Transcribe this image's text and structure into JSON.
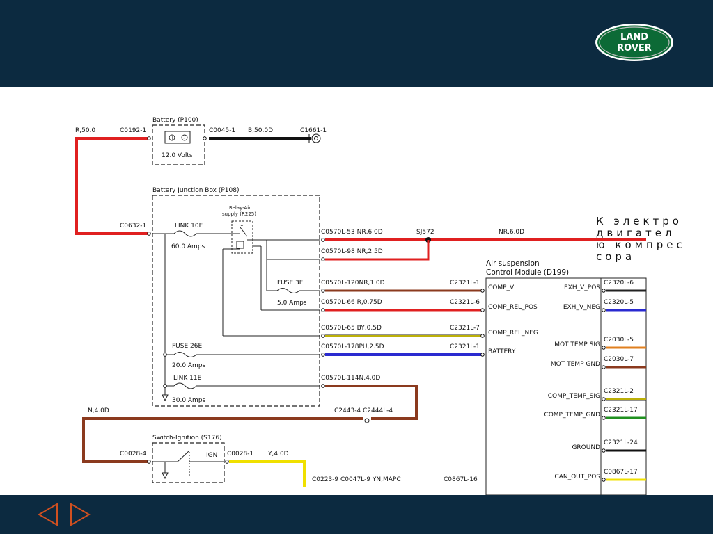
{
  "brand": {
    "logo_line1": "LAND",
    "logo_line2": "ROVER"
  },
  "annotation": "К электродвигателю компрессора",
  "battery": {
    "title": "Battery (P100)",
    "voltage": "12.0 Volts",
    "wire_in": "R,50.0",
    "conn_in": "C0192-1",
    "conn_out": "C0045-1",
    "wire_out": "B,50.0D",
    "ground": "C1661-1"
  },
  "junction_box": {
    "title": "Battery Junction Box (P108)",
    "conn": "C0632-1",
    "link10e": "LINK 10E",
    "link10e_amps": "60.0 Amps",
    "relay_title": "Relay-Air",
    "relay_sub": "supply (R225)",
    "relay_pin": "1",
    "fuse3e": "FUSE 3E",
    "fuse3e_amps": "5.0 Amps",
    "fuse26e": "FUSE 26E",
    "fuse26e_amps": "20.0 Amps",
    "link11e": "LINK 11E",
    "link11e_amps": "30.0 Amps"
  },
  "wires": {
    "w1": "C0570L-53 NR,6.0D",
    "splice": "SJ572",
    "w1b": "NR,6.0D",
    "w2": "C0570L-98 NR,2.5D",
    "w3": "C0570L-120NR,1.0D",
    "w3c": "C2321L-1",
    "w4": "C0570L-66 R,0.75D",
    "w4c": "C2321L-6",
    "w5": "C0570L-65 BY,0.5D",
    "w5c": "C2321L-7",
    "w6": "C0570L-178PU,2.5D",
    "w6c": "C2321L-1",
    "w7": "C0570L-114N,4.0D",
    "w8": "N,4.0D",
    "w8c": "C2443-4 C2444L-4",
    "w9c": "C0028-4",
    "w10c": "C0028-1",
    "w10": "Y,4.0D",
    "w11": "C0223-9 C0047L-9  YN,MAPC",
    "w12c": "C0867L-16"
  },
  "ignition": {
    "title": "Switch-Ignition (S176)",
    "ign": "IGN"
  },
  "module": {
    "title1": "Air suspension",
    "title2": "Control Module (D199)",
    "left_pins": [
      "COMP_V",
      "COMP_REL_POS",
      "COMP_REL_NEG",
      "BATTERY"
    ],
    "right_pins": [
      "EXH_V_POS",
      "EXH_V_NEG",
      "MOT TEMP SIG",
      "MOT TEMP GND",
      "COMP_TEMP_SIG",
      "COMP_TEMP_GND",
      "GROUND",
      "CAN_OUT_POS"
    ],
    "right_conns": [
      "C2320L-6",
      "C2320L-5",
      "C2030L-5",
      "C2030L-7",
      "C2321L-2",
      "C2321L-17",
      "C2321L-24",
      "C0867L-17"
    ]
  },
  "colors": {
    "navy": "#0c2a40",
    "red": "#e02020",
    "brown": "#8b3a1e",
    "yellow": "#f0e000",
    "blue": "#2a2ad0",
    "orange": "#e08020",
    "green": "#209020"
  }
}
